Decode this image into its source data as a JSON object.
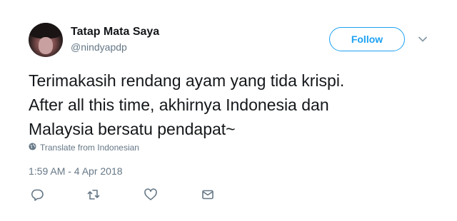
{
  "user": {
    "name": "Tatap Mata Saya",
    "handle": "@nindyapdp"
  },
  "follow_button": {
    "label": "Follow"
  },
  "tweet": {
    "text": "Terimakasih rendang ayam yang tida krispi.\nAfter all this time, akhirnya Indonesia dan\nMalaysia bersatu pendapat~",
    "translate_label": "Translate from Indonesian",
    "timestamp": "1:59 AM - 4 Apr 2018"
  },
  "icons": {
    "menu": "chevron-down-icon",
    "translate": "globe-icon",
    "actions": [
      "reply-icon",
      "retweet-icon",
      "like-icon",
      "message-icon"
    ]
  },
  "colors": {
    "accent": "#1da1f2",
    "secondary_text": "#657786",
    "primary_text": "#14171a"
  }
}
